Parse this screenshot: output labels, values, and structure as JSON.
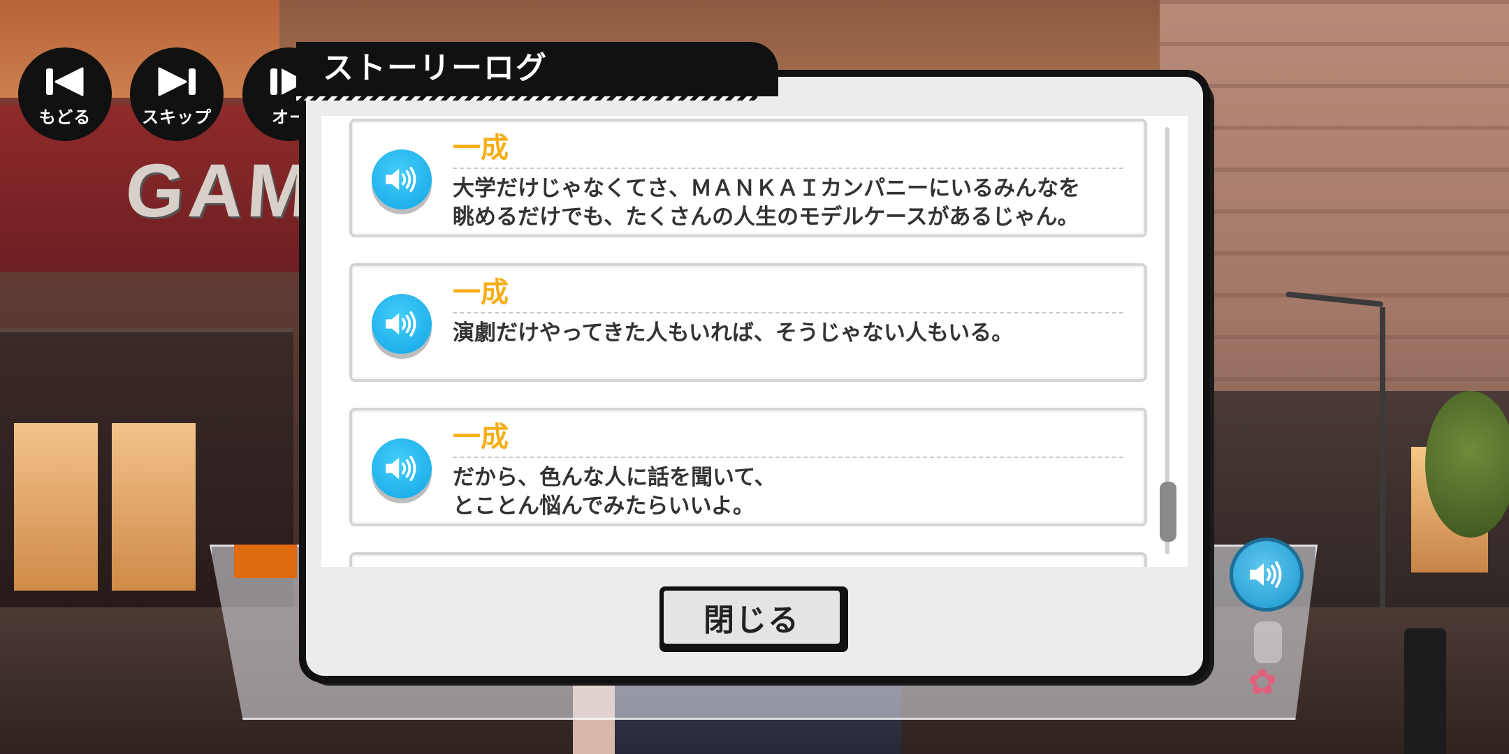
{
  "controls": {
    "back_label": "もどる",
    "skip_label": "スキップ",
    "auto_label": "オー"
  },
  "background": {
    "sign_text": "GAM"
  },
  "dialog": {
    "title": "ストーリーログ",
    "close_label": "閉じる"
  },
  "log": [
    {
      "speaker": "一成",
      "text": "大学だけじゃなくてさ、ＭＡＮＫＡＩカンパニーにいるみんなを\n眺めるだけでも、たくさんの人生のモデルケースがあるじゃん。"
    },
    {
      "speaker": "一成",
      "text": "演劇だけやってきた人もいれば、そうじゃない人もいる。"
    },
    {
      "speaker": "一成",
      "text": "だから、色んな人に話を聞いて、\nとことん悩んでみたらいいよ。"
    }
  ],
  "colors": {
    "speaker_name": "#f5ae16",
    "voice_button": "#12a6e6",
    "dialog_frame": "#111111"
  }
}
